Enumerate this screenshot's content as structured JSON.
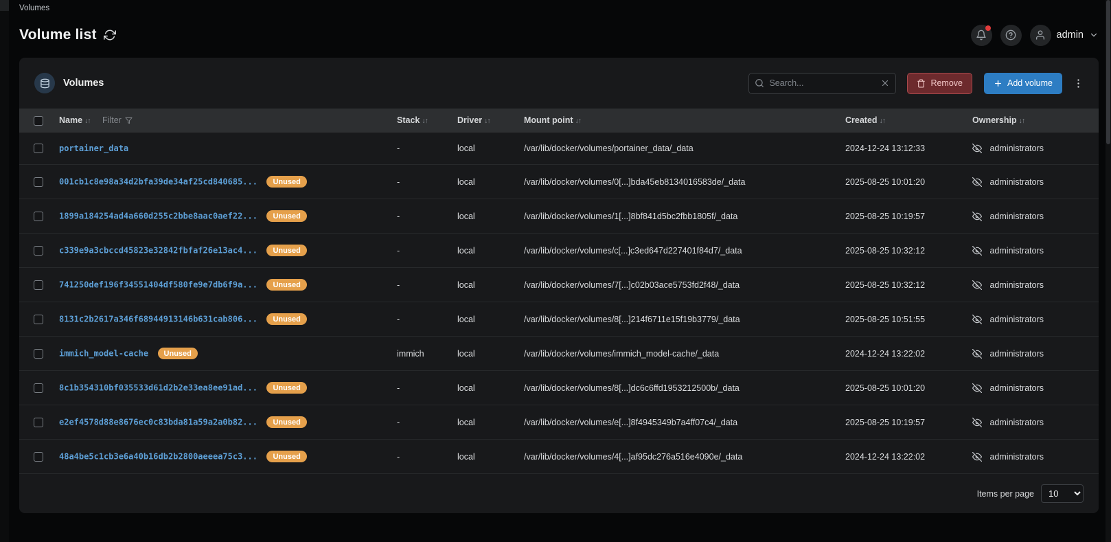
{
  "breadcrumb": {
    "label": "Volumes"
  },
  "page": {
    "title": "Volume list"
  },
  "topbar": {
    "user_name": "admin"
  },
  "panel": {
    "title": "Volumes",
    "search_placeholder": "Search...",
    "remove_label": "Remove",
    "add_volume_label": "Add volume"
  },
  "table": {
    "headers": {
      "name": "Name",
      "filter": "Filter",
      "stack": "Stack",
      "driver": "Driver",
      "mount_point": "Mount point",
      "created": "Created",
      "ownership": "Ownership"
    },
    "rows": [
      {
        "name": "portainer_data",
        "unused": false,
        "stack": "-",
        "driver": "local",
        "mount": "/var/lib/docker/volumes/portainer_data/_data",
        "created": "2024-12-24 13:12:33",
        "ownership": "administrators"
      },
      {
        "name": "001cb1c8e98a34d2bfa39de34af25cd840685...",
        "unused": true,
        "stack": "-",
        "driver": "local",
        "mount": "/var/lib/docker/volumes/0[...]bda45eb8134016583de/_data",
        "created": "2025-08-25 10:01:20",
        "ownership": "administrators"
      },
      {
        "name": "1899a184254ad4a660d255c2bbe8aac0aef22...",
        "unused": true,
        "stack": "-",
        "driver": "local",
        "mount": "/var/lib/docker/volumes/1[...]8bf841d5bc2fbb1805f/_data",
        "created": "2025-08-25 10:19:57",
        "ownership": "administrators"
      },
      {
        "name": "c339e9a3cbccd45823e32842fbfaf26e13ac4...",
        "unused": true,
        "stack": "-",
        "driver": "local",
        "mount": "/var/lib/docker/volumes/c[...]c3ed647d227401f84d7/_data",
        "created": "2025-08-25 10:32:12",
        "ownership": "administrators"
      },
      {
        "name": "741250def196f34551404df580fe9e7db6f9a...",
        "unused": true,
        "stack": "-",
        "driver": "local",
        "mount": "/var/lib/docker/volumes/7[...]c02b03ace5753fd2f48/_data",
        "created": "2025-08-25 10:32:12",
        "ownership": "administrators"
      },
      {
        "name": "8131c2b2617a346f68944913146b631cab806...",
        "unused": true,
        "stack": "-",
        "driver": "local",
        "mount": "/var/lib/docker/volumes/8[...]214f6711e15f19b3779/_data",
        "created": "2025-08-25 10:51:55",
        "ownership": "administrators"
      },
      {
        "name": "immich_model-cache",
        "unused": true,
        "stack": "immich",
        "driver": "local",
        "mount": "/var/lib/docker/volumes/immich_model-cache/_data",
        "created": "2024-12-24 13:22:02",
        "ownership": "administrators"
      },
      {
        "name": "8c1b354310bf035533d61d2b2e33ea8ee91ad...",
        "unused": true,
        "stack": "-",
        "driver": "local",
        "mount": "/var/lib/docker/volumes/8[...]dc6c6ffd1953212500b/_data",
        "created": "2025-08-25 10:01:20",
        "ownership": "administrators"
      },
      {
        "name": "e2ef4578d88e8676ec0c83bda81a59a2a0b82...",
        "unused": true,
        "stack": "-",
        "driver": "local",
        "mount": "/var/lib/docker/volumes/e[...]8f4945349b7a4ff07c4/_data",
        "created": "2025-08-25 10:19:57",
        "ownership": "administrators"
      },
      {
        "name": "48a4be5c1cb3e6a40b16db2b2800aeeea75c3...",
        "unused": true,
        "stack": "-",
        "driver": "local",
        "mount": "/var/lib/docker/volumes/4[...]af95dc276a516e4090e/_data",
        "created": "2024-12-24 13:22:02",
        "ownership": "administrators"
      }
    ]
  },
  "badges": {
    "unused": "Unused"
  },
  "footer": {
    "items_per_page_label": "Items per page",
    "items_per_page_value": "10"
  },
  "icons": {
    "sort": "↓↑",
    "kebab": "⋮"
  },
  "colors": {
    "accent_blue": "#2d7dc3",
    "link_blue": "#5d9fd6",
    "badge_orange": "#e5a04b",
    "danger_red": "#6d2a2d",
    "notification_red": "#e23b3b",
    "panel_bg": "#18191b",
    "page_bg": "#060708"
  }
}
